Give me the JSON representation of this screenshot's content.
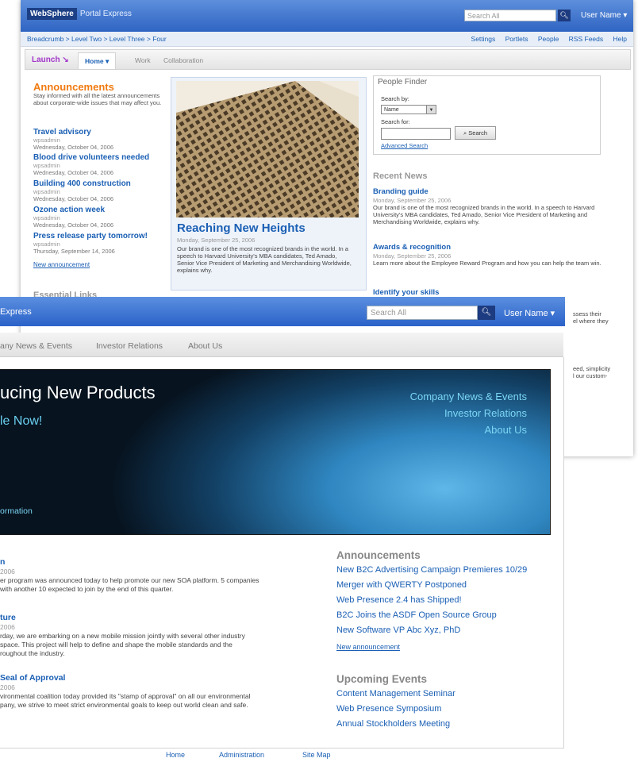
{
  "back": {
    "brand": "WebSphere",
    "product": "Portal Express",
    "search_placeholder": "Search All",
    "user": "User Name ▾",
    "breadcrumb": "Breadcrumb > Level Two > Level Three > Four",
    "utilities": [
      "Settings",
      "Portlets",
      "People",
      "RSS Feeds",
      "Help"
    ],
    "launch": "Launch ↘",
    "tabs": [
      "Home ▾",
      "Work",
      "Collaboration"
    ],
    "announcements": {
      "title": "Announcements",
      "desc": "Stay informed with all the latest announcements about corporate-wide issues that may affect you.",
      "items": [
        {
          "title": "Travel advisory",
          "author": "wpsadmin",
          "date": "Wednesday, October 04, 2006"
        },
        {
          "title": "Blood drive volunteers needed",
          "author": "wpsadmin",
          "date": "Wednesday, October 04, 2006"
        },
        {
          "title": "Building 400 construction",
          "author": "wpsadmin",
          "date": "Wednesday, October 04, 2006"
        },
        {
          "title": "Ozone action week",
          "author": "wpsadmin",
          "date": "Wednesday, October 04, 2006"
        },
        {
          "title": "Press release party tomorrow!",
          "author": "wpsadmin",
          "date": "Thursday, September 14, 2006"
        }
      ],
      "new_link": "New announcement"
    },
    "essential_links": "Essential Links",
    "feature": {
      "title": "Reaching New Heights",
      "date": "Monday, September 25, 2006",
      "body": "Our brand is one of the most recognized brands in the world. In a speech to Harvard University's MBA candidates, Ted Amado, Senior Vice President of Marketing and Merchandising Worldwide, explains why."
    },
    "people_finder": {
      "title": "People Finder",
      "search_by_label": "Search by:",
      "search_by_value": "Name",
      "search_for_label": "Search for:",
      "search_button": "Search",
      "advanced": "Advanced Search"
    },
    "recent_news": {
      "title": "Recent News",
      "items": [
        {
          "title": "Branding guide",
          "date": "Monday, September 25, 2006",
          "body": "Our brand is one of the most recognized brands in the world. In a speech to Harvard University's MBA candidates, Ted Amado, Senior Vice President of Marketing and Merchandising Worldwide, explains why."
        },
        {
          "title": "Awards & recognition",
          "date": "Monday, September 25, 2006",
          "body": "Learn more about the Employee Reward Program and how you can help the team win."
        },
        {
          "title": "Identify your skills",
          "date": "",
          "body": ""
        }
      ]
    },
    "fragments": [
      "ssess their",
      "el where they",
      "eed, simplicity",
      "l our custom-"
    ]
  },
  "front": {
    "brand": "Express",
    "search_placeholder": "Search All",
    "user": "User Name ▾",
    "nav": [
      "any News & Events",
      "Investor Relations",
      "About Us"
    ],
    "hero": {
      "title": "ucing New Products",
      "subtitle": "le Now!",
      "links": [
        "Company News & Events",
        "Investor Relations",
        "About Us"
      ],
      "more": "ormation"
    },
    "stories": [
      {
        "title": "n",
        "date": "2006",
        "body": [
          "er program was announced today to help promote our new SOA platform. 5 companies",
          "with another 10 expected to join by the end of this quarter."
        ]
      },
      {
        "title": "ture",
        "date": "2006",
        "body": [
          "rday, we are embarking on a new mobile mission jointly with several other industry",
          "space. This project will help to define and shape the mobile standards and the",
          "roughout the industry."
        ]
      },
      {
        "title": "Seal of Approval",
        "date": "2006",
        "body": [
          "vironmental coalition today provided its \"stamp of approval\" on all our environmental",
          "pany, we strive to meet strict environmental goals to keep out world clean and safe."
        ]
      }
    ],
    "announcements": {
      "title": "Announcements",
      "items": [
        "New B2C Advertising Campaign Premieres 10/29",
        "Merger with QWERTY Postponed",
        "Web Presence 2.4 has Shipped!",
        "B2C Joins the ASDF Open Source Group",
        "New Software VP Abc Xyz, PhD"
      ],
      "new_link": "New announcement"
    },
    "events": {
      "title": "Upcoming Events",
      "items": [
        "Content Management Seminar",
        "Web Presence Symposium",
        "Annual Stockholders Meeting"
      ]
    },
    "footer": [
      "Home",
      "Administration",
      "Site Map"
    ]
  }
}
